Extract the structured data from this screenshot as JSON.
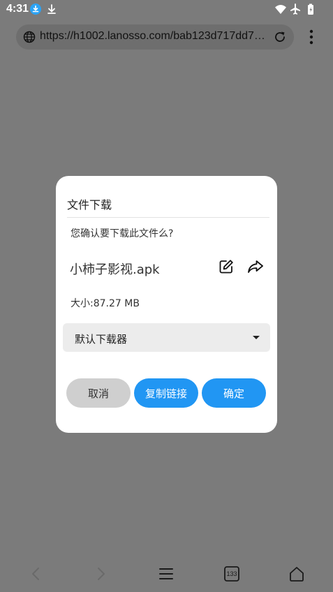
{
  "status_bar": {
    "time": "4:31"
  },
  "browser": {
    "url": "https://h1002.lanosso.com/bab123d717dd7…",
    "tab_count": "133"
  },
  "dialog": {
    "title": "文件下载",
    "question": "您确认要下载此文件么?",
    "file_name": "小柿子影视.apk",
    "file_size": "大小:87.27 MB",
    "downloader": "默认下载器",
    "buttons": {
      "cancel": "取消",
      "copy_link": "复制链接",
      "confirm": "确定"
    }
  },
  "icons": {
    "status": [
      "download-app-icon",
      "download-arrow-icon",
      "wifi-icon",
      "airplane-icon",
      "battery-icon"
    ],
    "toolbar": [
      "globe-icon",
      "reload-icon",
      "more-menu-icon"
    ],
    "nav": [
      "back-icon",
      "forward-icon",
      "menu-icon",
      "tabs-icon",
      "home-icon"
    ]
  },
  "colors": {
    "primary": "#2196f3",
    "cancel_button": "#cfcfcf",
    "scrim": "#7b7b7b"
  }
}
